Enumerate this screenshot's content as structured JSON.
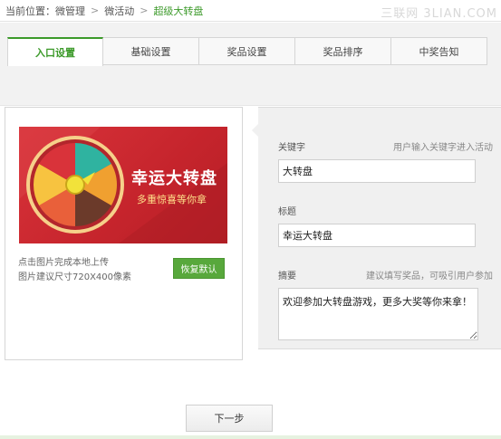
{
  "breadcrumb": {
    "prefix": "当前位置：",
    "items": [
      "微管理",
      "微活动",
      "超级大转盘"
    ],
    "separator": ">"
  },
  "watermark": "三联网 3LIAN.COM",
  "tabs": [
    {
      "label": "入口设置",
      "active": true
    },
    {
      "label": "基础设置",
      "active": false
    },
    {
      "label": "奖品设置",
      "active": false
    },
    {
      "label": "奖品排序",
      "active": false
    },
    {
      "label": "中奖告知",
      "active": false
    }
  ],
  "banner": {
    "title": "幸运大转盘",
    "subtitle": "多重惊喜等你拿",
    "wheel_colors": [
      "#2fb3a0",
      "#f0a030",
      "#6b3a2a",
      "#e9603a",
      "#f7c340",
      "#d9333a"
    ]
  },
  "upload": {
    "hint1": "点击图片完成本地上传",
    "hint2": "图片建议尺寸720X400像素",
    "restore_label": "恢复默认"
  },
  "form": {
    "keyword": {
      "label": "关键字",
      "tip": "用户输入关键字进入活动",
      "value": "大转盘"
    },
    "title": {
      "label": "标题",
      "value": "幸运大转盘"
    },
    "summary": {
      "label": "摘要",
      "tip": "建议填写奖品，可吸引用户参加",
      "value": "欢迎参加大转盘游戏，更多大奖等你来拿！"
    }
  },
  "next_label": "下一步",
  "colors": {
    "accent": "#3c9a2a",
    "button": "#58a83c"
  }
}
